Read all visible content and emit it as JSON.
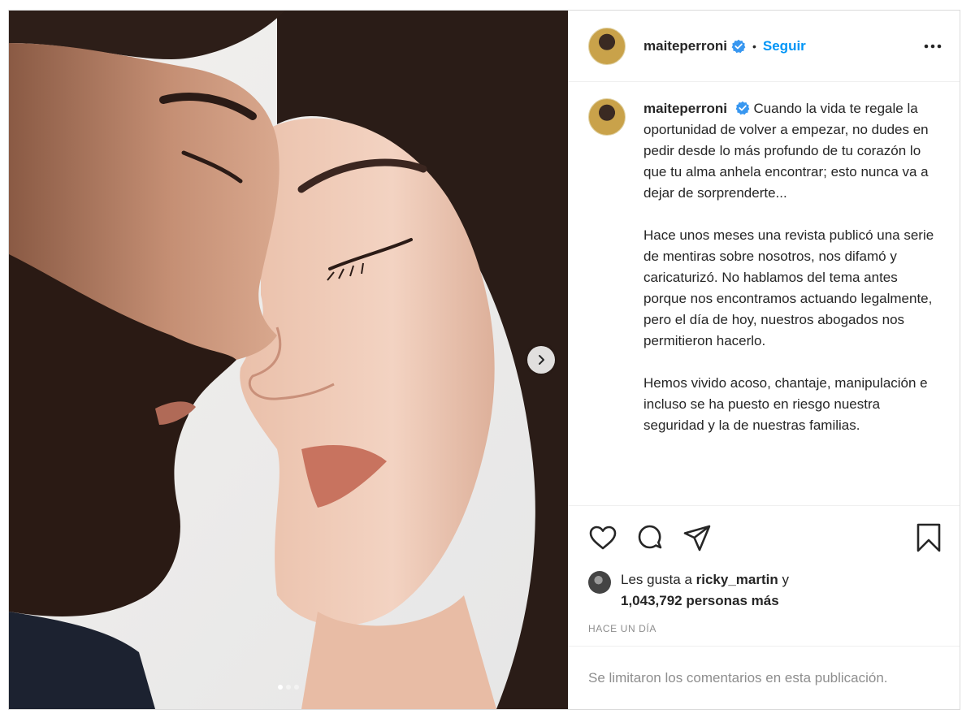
{
  "header": {
    "username": "maiteperroni",
    "separator": "•",
    "follow_label": "Seguir"
  },
  "caption": {
    "username": "maiteperroni",
    "paragraphs": [
      "Cuando la vida te regale la oportunidad de volver a empezar, no dudes en pedir desde lo más profundo de tu corazón lo que tu alma anhela encontrar; esto nunca va a dejar de sorprenderte...",
      "Hace unos meses una revista publicó una serie de mentiras sobre nosotros, nos difamó y caricaturizó. No hablamos del tema antes porque nos encontramos actuando legalmente, pero el día de hoy, nuestros abogados nos permitieron hacerlo.",
      "Hemos vivido acoso, chantaje, manipulación e incluso se ha puesto en riesgo nuestra seguridad y la de nuestras familias."
    ]
  },
  "likes": {
    "prefix": "Les gusta a",
    "user": "ricky_martin",
    "conjunction": "y",
    "count_text": "1,043,792 personas más"
  },
  "timestamp": "HACE UN DÍA",
  "comments_notice": "Se limitaron los comentarios en esta publicación.",
  "carousel": {
    "slide_count": 3,
    "active_index": 0
  },
  "colors": {
    "accent": "#0095f6",
    "verified": "#3897f0",
    "muted": "#8e8e8e",
    "text": "#262626"
  },
  "icons": [
    "verified-badge-icon",
    "more-options-icon",
    "chevron-right-icon",
    "heart-icon",
    "comment-icon",
    "share-icon",
    "bookmark-icon"
  ]
}
